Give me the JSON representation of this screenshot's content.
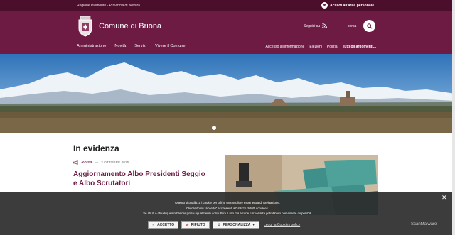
{
  "topbar": {
    "region": "Regione Piemonte - Provincia di Novara",
    "login_label": "Accedi all'area personale"
  },
  "header": {
    "site_name": "Comune di Briona",
    "social_label": "Seguici su",
    "search_label": "cerca",
    "nav_main": [
      "Amministrazione",
      "Novità",
      "Servizi",
      "Vivere il Comune"
    ],
    "nav_secondary": [
      "Accesso all'informazione",
      "Elezioni",
      "Polizia",
      "Tutti gli argomenti..."
    ]
  },
  "hero": {
    "slide_index": 1
  },
  "evidenza": {
    "title": "In evidenza",
    "category": "AVVISI",
    "date": "2 OTTOBRE 2025",
    "headline": "Aggiornamento Albo Presidenti Seggio e Albo Scrutatori"
  },
  "cookie": {
    "line1": "Questo sito utilizza i cookie per offrirti una migliore esperienza di navigazione.",
    "line2": "Cliccando su \"Accetto\" acconsenti all'utilizzo di tutti i cookies.",
    "line3": "Se rifiuti o chiudi questo banner potrai ugualmente consultare il sito ma alcune funzionalità potrebbero non essere disponibili.",
    "accept_label": "ACCETTO",
    "reject_label": "RIFIUTO",
    "customize_label": "PERSONALIZZA",
    "policy_label": "Leggi la Cookies policy"
  },
  "watermark": "ScanMalware",
  "colors": {
    "brand": "#6e1b44",
    "brand_dark": "#4b0f2b"
  }
}
